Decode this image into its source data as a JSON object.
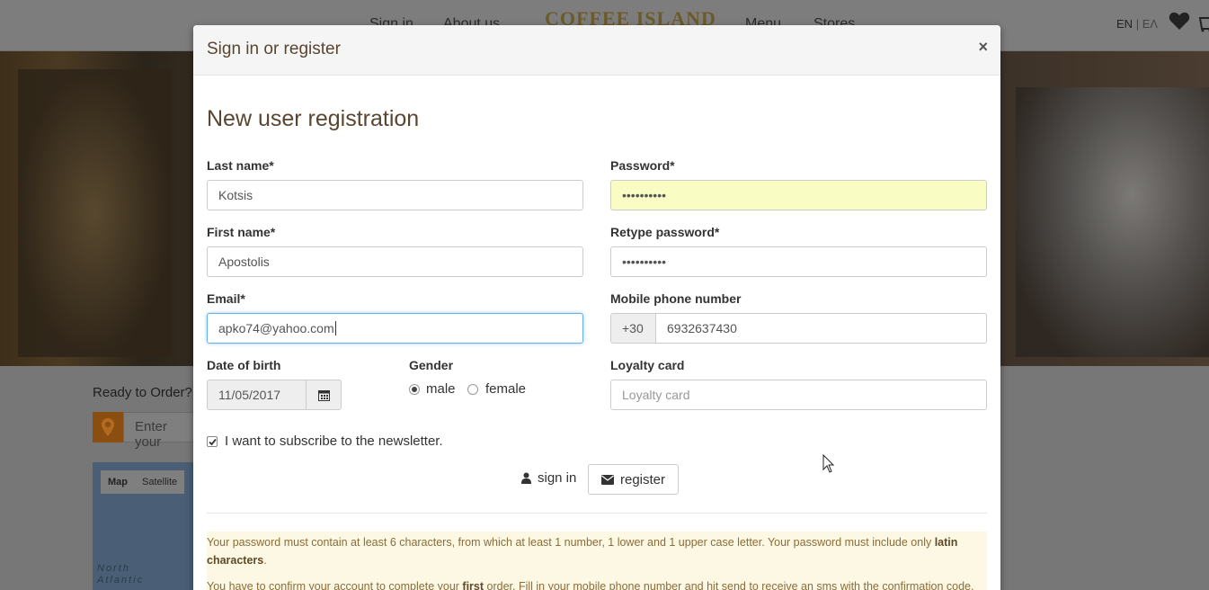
{
  "background": {
    "nav": {
      "signin": "Sign in",
      "about": "About us",
      "logo": "COFFEE ISLAND",
      "menu": "Menu",
      "stores": "Stores"
    },
    "lang": {
      "current": "EN",
      "separator": "|",
      "other": "ΕΛ"
    },
    "ready_text": "Ready to Order? L",
    "address_placeholder": "Enter your",
    "map": {
      "map_btn": "Map",
      "satellite_btn": "Satellite",
      "ocean_label_1": "North",
      "ocean_label_2": "Atlantic"
    }
  },
  "modal": {
    "title": "Sign in or register",
    "close": "×",
    "section_title": "New user registration",
    "last_name": {
      "label": "Last name*",
      "value": "Kotsis"
    },
    "first_name": {
      "label": "First name*",
      "value": "Apostolis"
    },
    "email": {
      "label": "Email*",
      "value": "apko74@yahoo.com"
    },
    "password": {
      "label": "Password*",
      "value": "••••••••••"
    },
    "retype_password": {
      "label": "Retype password*",
      "value": "••••••••••"
    },
    "mobile": {
      "label": "Mobile phone number",
      "prefix": "+30",
      "value": "6932637430"
    },
    "dob": {
      "label": "Date of birth",
      "value": "11/05/2017"
    },
    "gender": {
      "label": "Gender",
      "male": "male",
      "female": "female",
      "selected": "male"
    },
    "loyalty": {
      "label": "Loyalty card",
      "placeholder": "Loyalty card"
    },
    "newsletter": {
      "label": "I want to subscribe to the newsletter.",
      "checked": true
    },
    "signin_label": "sign in",
    "register_label": "register",
    "notice": {
      "p1_pre": "Your password must contain at least 6 characters, from which at least 1 number, 1 lower and 1 upper case letter. Your password must include only ",
      "p1_bold": "latin characters",
      "p1_post": ".",
      "p2_pre": "You have to confirm your account to complete your ",
      "p2_bold": "first",
      "p2_post": " order. Fill in your mobile phone number and hit send to receive an sms with the confirmation code."
    }
  },
  "colors": {
    "accent_text": "#5a4530",
    "notice_bg": "#fcf8e3",
    "autofill_bg": "#fafdc3",
    "focus_border": "#66afe9"
  }
}
